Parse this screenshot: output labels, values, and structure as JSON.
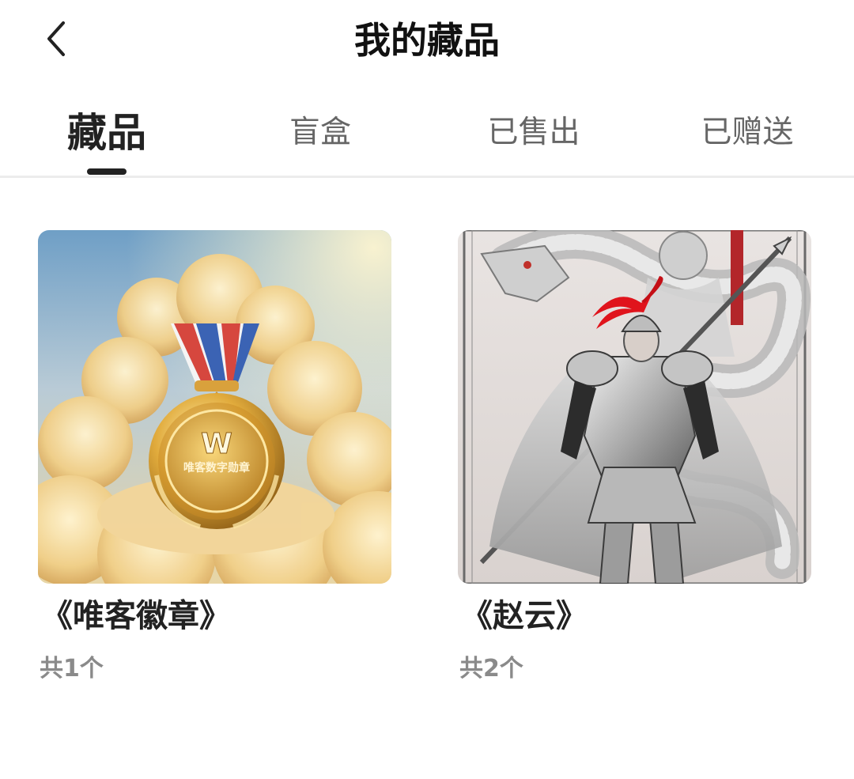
{
  "header": {
    "title": "我的藏品",
    "back_icon": "chevron-left-icon"
  },
  "tabs": [
    {
      "label": "藏品",
      "active": true
    },
    {
      "label": "盲盒",
      "active": false
    },
    {
      "label": "已售出",
      "active": false
    },
    {
      "label": "已赠送",
      "active": false
    }
  ],
  "items": [
    {
      "title": "《唯客徽章》",
      "count": "共1个",
      "medal_logo": "W",
      "medal_text": "唯客数字勋章"
    },
    {
      "title": "《赵云》",
      "count": "共2个"
    }
  ],
  "colors": {
    "text_primary": "#222222",
    "text_secondary": "#8a8a8a",
    "tab_inactive": "#666666",
    "divider": "#ececec",
    "plume_red": "#e0141c"
  }
}
